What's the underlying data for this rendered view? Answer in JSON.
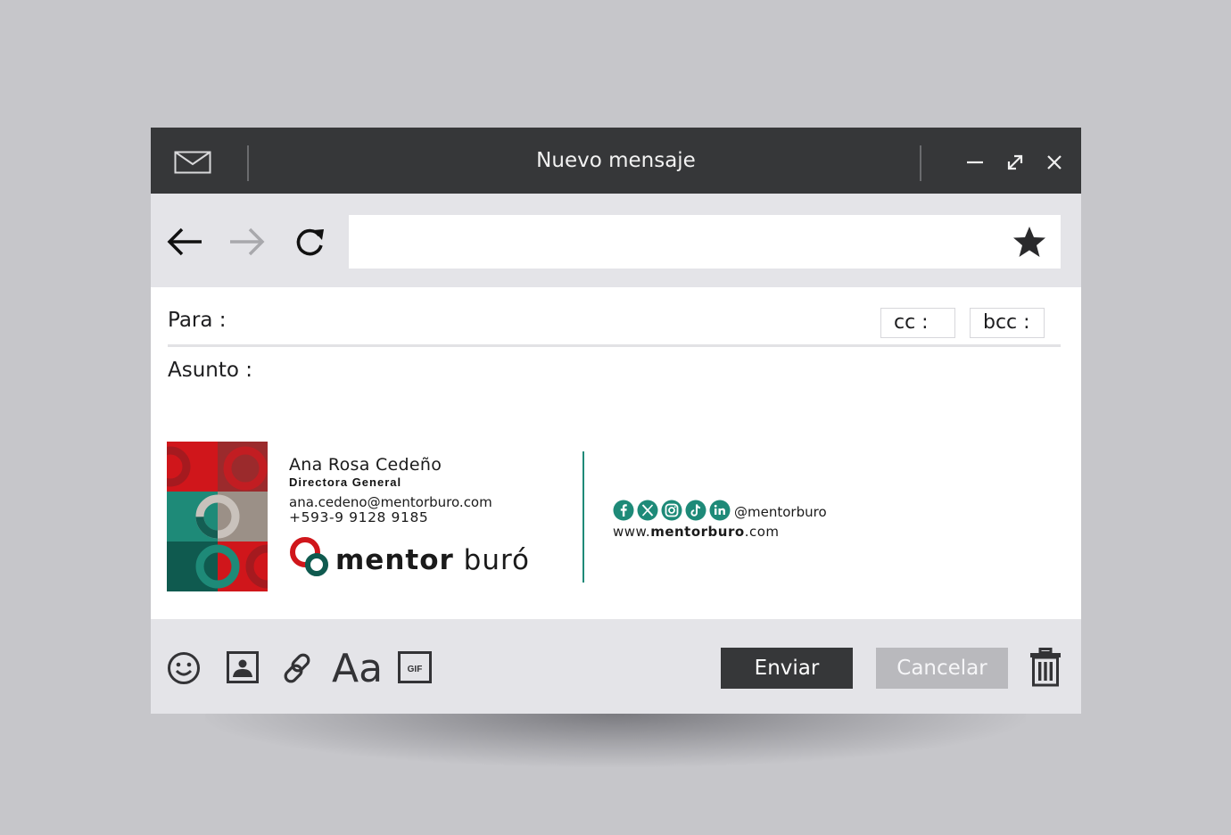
{
  "window": {
    "title": "Nuevo mensaje",
    "icons": [
      "mail-icon",
      "minimize-icon",
      "maximize-icon",
      "close-icon"
    ]
  },
  "nav": {
    "icons": [
      "back-arrow-icon",
      "forward-arrow-icon",
      "reload-icon",
      "star-icon"
    ],
    "url_value": ""
  },
  "compose": {
    "to_label": "Para :",
    "cc_label": "cc :",
    "bcc_label": "bcc :",
    "subject_label": "Asunto :"
  },
  "signature": {
    "name": "Ana Rosa Cedeño",
    "role": "Directora General",
    "email": "ana.cedeno@mentorburo.com",
    "phone": "+593-9 9128 9185",
    "brand_bold": "mentor",
    "brand_light": "buró",
    "social_icons": [
      "facebook-icon",
      "x-icon",
      "instagram-icon",
      "tiktok-icon",
      "linkedin-icon"
    ],
    "handle": "@mentorburo",
    "web_prefix": "www.",
    "web_bold": "mentorburo",
    "web_suffix": ".com",
    "colors": {
      "red": "#d0161b",
      "teal": "#1e8a78",
      "dark_teal": "#0f5a4f"
    }
  },
  "toolbar": {
    "icons": [
      "emoji-icon",
      "image-icon",
      "link-icon",
      "text-format-icon",
      "gif-icon",
      "trash-icon"
    ],
    "text_format_label": "Aa",
    "gif_label": "GIF",
    "send_label": "Enviar",
    "cancel_label": "Cancelar"
  },
  "colors": {
    "titlebar": "#363739",
    "panel": "#e4e4e8",
    "background": "#c6c6ca",
    "cancel": "#b9b9bd"
  }
}
